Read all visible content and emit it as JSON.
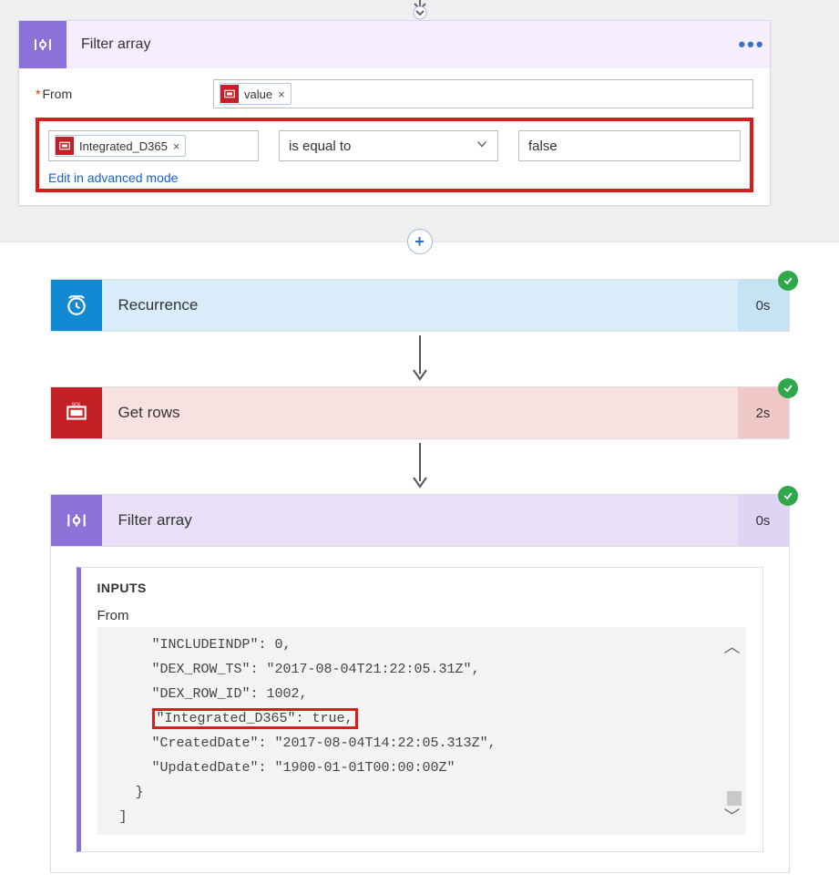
{
  "designer": {
    "filter_card_title": "Filter array",
    "from_label": "From",
    "from_token": "value",
    "cond_left_token": "Integrated_D365",
    "cond_operator": "is equal to",
    "cond_right_value": "false",
    "advanced_link": "Edit in advanced mode"
  },
  "run": {
    "recurrence": {
      "title": "Recurrence",
      "duration": "0s"
    },
    "getrows": {
      "title": "Get rows",
      "duration": "2s"
    },
    "filter": {
      "title": "Filter array",
      "duration": "0s"
    },
    "inputs_heading": "INPUTS",
    "from_heading": "From",
    "json_lines": [
      "    \"INCLUDEINDP\": 0,",
      "    \"DEX_ROW_TS\": \"2017-08-04T21:22:05.31Z\",",
      "    \"DEX_ROW_ID\": 1002,",
      "    \"Integrated_D365\": true,",
      "    \"CreatedDate\": \"2017-08-04T14:22:05.313Z\",",
      "    \"UpdatedDate\": \"1900-01-01T00:00:00Z\"",
      "  }",
      "]"
    ],
    "json_highlight_index": 3
  }
}
